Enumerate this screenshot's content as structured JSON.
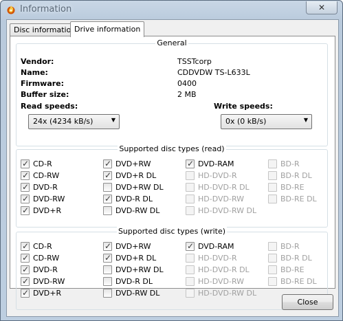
{
  "window": {
    "title": "Information",
    "close_glyph": "✕"
  },
  "tabs": [
    {
      "label": "Disc information",
      "active": false
    },
    {
      "label": "Drive information",
      "active": true
    }
  ],
  "general": {
    "title": "General",
    "rows": [
      {
        "label": "Vendor:",
        "value": "TSSTcorp"
      },
      {
        "label": "Name:",
        "value": "CDDVDW TS-L633L"
      },
      {
        "label": "Firmware:",
        "value": "0400"
      },
      {
        "label": "Buffer size:",
        "value": "2 MB"
      }
    ],
    "read_speeds_label": "Read speeds:",
    "read_speed_value": "24x (4234 kB/s)",
    "write_speeds_label": "Write speeds:",
    "write_speed_value": "0x (0 kB/s)"
  },
  "read_types": {
    "title": "Supported disc types (read)",
    "columns": [
      [
        {
          "label": "CD-R",
          "checked": true,
          "enabled": true
        },
        {
          "label": "CD-RW",
          "checked": true,
          "enabled": true
        },
        {
          "label": "DVD-R",
          "checked": true,
          "enabled": true
        },
        {
          "label": "DVD-RW",
          "checked": true,
          "enabled": true
        },
        {
          "label": "DVD+R",
          "checked": true,
          "enabled": true
        }
      ],
      [
        {
          "label": "DVD+RW",
          "checked": true,
          "enabled": true
        },
        {
          "label": "DVD+R DL",
          "checked": true,
          "enabled": true
        },
        {
          "label": "DVD+RW DL",
          "checked": false,
          "enabled": true
        },
        {
          "label": "DVD-R DL",
          "checked": true,
          "enabled": true
        },
        {
          "label": "DVD-RW DL",
          "checked": false,
          "enabled": true
        }
      ],
      [
        {
          "label": "DVD-RAM",
          "checked": true,
          "enabled": true
        },
        {
          "label": "HD-DVD-R",
          "checked": false,
          "enabled": false
        },
        {
          "label": "HD-DVD-R DL",
          "checked": false,
          "enabled": false
        },
        {
          "label": "HD-DVD-RW",
          "checked": false,
          "enabled": false
        },
        {
          "label": "HD-DVD-RW DL",
          "checked": false,
          "enabled": false
        }
      ],
      [
        {
          "label": "BD-R",
          "checked": false,
          "enabled": false
        },
        {
          "label": "BD-R DL",
          "checked": false,
          "enabled": false
        },
        {
          "label": "BD-RE",
          "checked": false,
          "enabled": false
        },
        {
          "label": "BD-RE DL",
          "checked": false,
          "enabled": false
        }
      ]
    ]
  },
  "write_types": {
    "title": "Supported disc types (write)",
    "columns": [
      [
        {
          "label": "CD-R",
          "checked": true,
          "enabled": true
        },
        {
          "label": "CD-RW",
          "checked": true,
          "enabled": true
        },
        {
          "label": "DVD-R",
          "checked": true,
          "enabled": true
        },
        {
          "label": "DVD-RW",
          "checked": true,
          "enabled": true
        },
        {
          "label": "DVD+R",
          "checked": true,
          "enabled": true
        }
      ],
      [
        {
          "label": "DVD+RW",
          "checked": true,
          "enabled": true
        },
        {
          "label": "DVD+R DL",
          "checked": true,
          "enabled": true
        },
        {
          "label": "DVD+RW DL",
          "checked": false,
          "enabled": true
        },
        {
          "label": "DVD-R DL",
          "checked": false,
          "enabled": true
        },
        {
          "label": "DVD-RW DL",
          "checked": false,
          "enabled": true
        }
      ],
      [
        {
          "label": "DVD-RAM",
          "checked": true,
          "enabled": true
        },
        {
          "label": "HD-DVD-R",
          "checked": false,
          "enabled": false
        },
        {
          "label": "HD-DVD-R DL",
          "checked": false,
          "enabled": false
        },
        {
          "label": "HD-DVD-RW",
          "checked": false,
          "enabled": false
        },
        {
          "label": "HD-DVD-RW DL",
          "checked": false,
          "enabled": false
        }
      ],
      [
        {
          "label": "BD-R",
          "checked": false,
          "enabled": false
        },
        {
          "label": "BD-R DL",
          "checked": false,
          "enabled": false
        },
        {
          "label": "BD-RE",
          "checked": false,
          "enabled": false
        },
        {
          "label": "BD-RE DL",
          "checked": false,
          "enabled": false
        }
      ]
    ]
  },
  "buttons": {
    "close": "Close"
  },
  "icons": {
    "app": "flame-disc-icon",
    "close": "close-icon",
    "dropdown": "chevron-down-icon",
    "check": "checkmark-icon"
  }
}
